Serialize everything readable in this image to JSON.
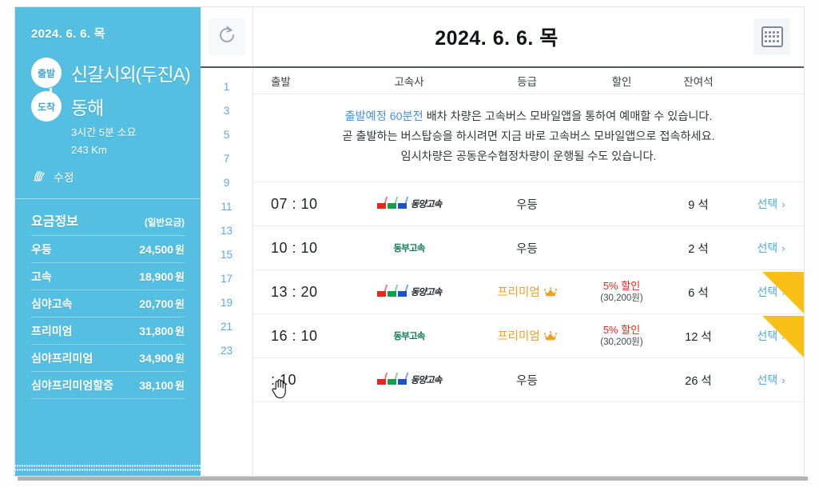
{
  "sidebar": {
    "date": "2024. 6. 6. 목",
    "depart_pin": "출발",
    "arrive_pin": "도착",
    "depart_name": "신갈시외(두진A)",
    "arrive_name": "동해",
    "duration": "3시간 5분 소요",
    "distance": "243 Km",
    "edit_label": "수정",
    "edit_icon": "pencil-hand-icon",
    "fare_title": "요금정보",
    "fare_subtitle": "(일반요금)",
    "fares": [
      {
        "grade": "우등",
        "amount": "24,500",
        "unit": "원"
      },
      {
        "grade": "고속",
        "amount": "18,900",
        "unit": "원"
      },
      {
        "grade": "심야고속",
        "amount": "20,700",
        "unit": "원"
      },
      {
        "grade": "프리미엄",
        "amount": "31,800",
        "unit": "원"
      },
      {
        "grade": "심야프리미엄",
        "amount": "34,900",
        "unit": "원"
      },
      {
        "grade": "심야프리미엄할증",
        "amount": "38,100",
        "unit": "원"
      }
    ],
    "bg_color": "#54bfe0"
  },
  "topbar": {
    "refresh_icon": "refresh-icon",
    "title": "2024. 6. 6. 목",
    "calendar_icon": "calendar-icon"
  },
  "hours": [
    "1",
    "3",
    "5",
    "7",
    "9",
    "11",
    "13",
    "15",
    "17",
    "19",
    "21",
    "23"
  ],
  "table": {
    "headers": {
      "time": "출발",
      "company": "고속사",
      "grade": "등급",
      "discount": "할인",
      "seats": "잔여석"
    },
    "notice": {
      "line1_highlight": "출발예정 60분전",
      "line1_rest": " 배차 차량은 고속버스 모바일앱을 통하여 예매할 수 있습니다.",
      "line2": "곧 출발하는 버스탑승을 하시려면 지금 바로 고속버스 모바일앱으로 접속하세요.",
      "line3": "임시차량은 공동운수협정차량이 운행될 수도 있습니다."
    },
    "select_label": "선택",
    "select_chevron": "›",
    "ribbon_label": "프리미엄",
    "rows": [
      {
        "time": "07 : 10",
        "company": "동양고속",
        "company_logo": "dongyang",
        "grade": "우등",
        "premium": false,
        "discount_pct": "",
        "discount_amount": "",
        "seats": "9 석",
        "ribbon": false
      },
      {
        "time": "10 : 10",
        "company": "동부고속",
        "company_logo": "dongbu",
        "grade": "우등",
        "premium": false,
        "discount_pct": "",
        "discount_amount": "",
        "seats": "2 석",
        "ribbon": false
      },
      {
        "time": "13 : 20",
        "company": "동양고속",
        "company_logo": "dongyang",
        "grade": "프리미엄",
        "premium": true,
        "discount_pct": "5% 할인",
        "discount_amount": "(30,200원)",
        "seats": "6 석",
        "ribbon": true
      },
      {
        "time": "16 : 10",
        "company": "동부고속",
        "company_logo": "dongbu",
        "grade": "프리미엄",
        "premium": true,
        "discount_pct": "5% 할인",
        "discount_amount": "(30,200원)",
        "seats": "12 석",
        "ribbon": true
      },
      {
        "time": ": 10",
        "company": "동양고속",
        "company_logo": "dongyang",
        "grade": "우등",
        "premium": false,
        "discount_pct": "",
        "discount_amount": "",
        "seats": "26 석",
        "ribbon": false
      }
    ]
  },
  "colors": {
    "accent_blue": "#54bfe0",
    "link_blue": "#4fa8dd",
    "premium_gold": "#f0a01e",
    "discount_red": "#e8271c",
    "ribbon_yellow": "#fac017"
  }
}
